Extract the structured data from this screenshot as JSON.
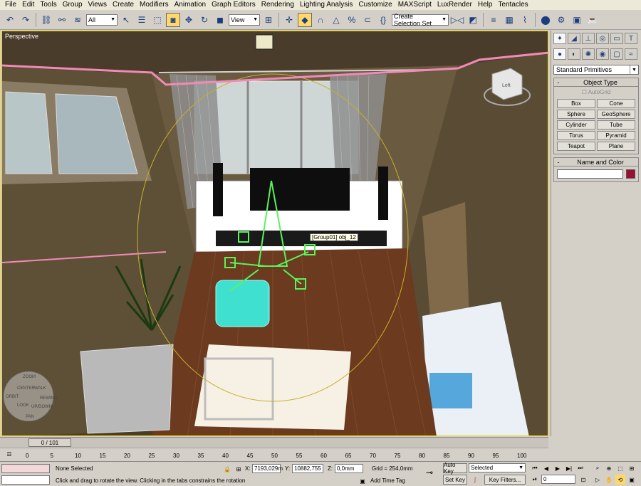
{
  "menu": [
    "File",
    "Edit",
    "Tools",
    "Group",
    "Views",
    "Create",
    "Modifiers",
    "Animation",
    "Graph Editors",
    "Rendering",
    "Lighting Analysis",
    "Customize",
    "MAXScript",
    "LuxRender",
    "Help",
    "Tentacles"
  ],
  "toolbar": {
    "filter_value": "All",
    "refcoord_value": "View",
    "selection_set_placeholder": "Create Selection Set"
  },
  "viewport": {
    "label": "Perspective",
    "tooltip": "[Group01] obj_12",
    "viewcube_label": "Left",
    "steering_labels": [
      "ZOOM",
      "ORBIT",
      "CENTER",
      "WALK",
      "REWIND",
      "PAN",
      "LOOK",
      "UP/DOWN"
    ]
  },
  "command_panel": {
    "dropdown_value": "Standard Primitives",
    "object_type_title": "Object Type",
    "autogrid_label": "AutoGrid",
    "buttons": [
      "Box",
      "Cone",
      "Sphere",
      "GeoSphere",
      "Cylinder",
      "Tube",
      "Torus",
      "Pyramid",
      "Teapot",
      "Plane"
    ],
    "name_color_title": "Name and Color",
    "color_swatch": "#9b0d33"
  },
  "timeline": {
    "frame_counter": "0 / 101",
    "ticks": [
      "0",
      "5",
      "10",
      "15",
      "20",
      "25",
      "30",
      "35",
      "40",
      "45",
      "50",
      "55",
      "60",
      "65",
      "70",
      "75",
      "80",
      "85",
      "90",
      "95",
      "100"
    ]
  },
  "status": {
    "selection": "None Selected",
    "prompt": "Click and drag to rotate the view.  Clicking in the tabs constrains the rotation",
    "x_label": "X:",
    "x_value": "7193,029m",
    "y_label": "Y:",
    "y_value": "10882,755",
    "z_label": "Z:",
    "z_value": "0,0mm",
    "grid": "Grid = 254,0mm",
    "add_time_tag": "Add Time Tag",
    "auto_key": "Auto Key",
    "set_key": "Set Key",
    "key_mode_value": "Selected",
    "key_filters": "Key Filters...",
    "current_frame": "0"
  }
}
